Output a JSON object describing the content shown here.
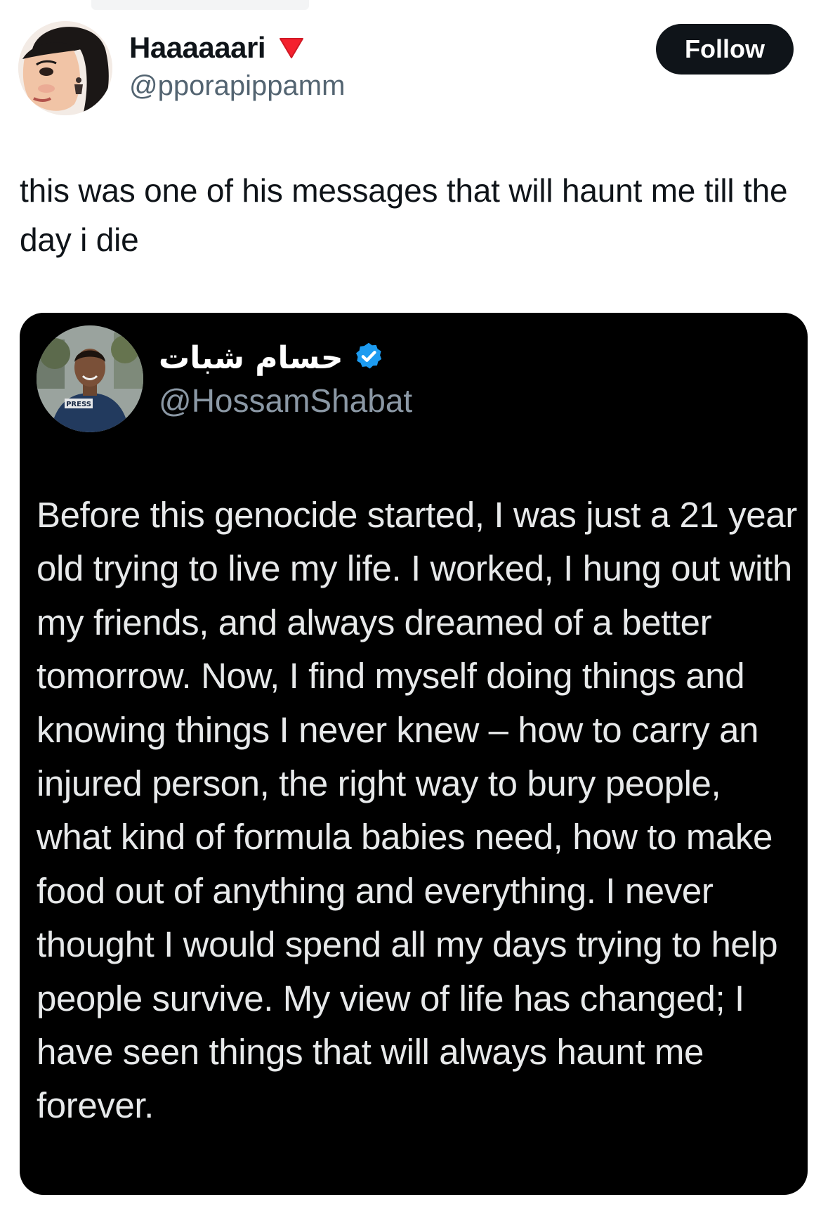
{
  "tweet": {
    "author": {
      "display_name": "Haaaaaari",
      "handle": "@pporapippamm",
      "badge_icon": "red-triangle-icon",
      "badge_color": "#f4212e"
    },
    "follow_label": "Follow",
    "text": "this was one of his messages that will haunt me till the day i die"
  },
  "quoted_tweet": {
    "author": {
      "display_name": "حسام شبات",
      "handle": "@HossamShabat",
      "verified_icon": "verified-badge-icon",
      "verified_color": "#1d9bf0"
    },
    "body": "Before this genocide started, I was just a 21 year old trying to live my life. I worked, I hung out with my friends, and always dreamed of a better tomorrow. Now, I find myself doing things and knowing things I never knew – how to carry an injured person, the right way to bury people, what kind of formula babies need, how to make food out of anything and everything. I never thought I would spend all my days trying to help people survive. My view of life has changed; I have seen things that will always haunt me forever.",
    "avatar_badge_text": "PRESS"
  },
  "colors": {
    "text_primary": "#0f1419",
    "text_secondary": "#536471",
    "follow_bg": "#0f1419",
    "card_bg": "#000000",
    "card_text": "#e7e9ea",
    "card_handle": "#8b98a5"
  }
}
